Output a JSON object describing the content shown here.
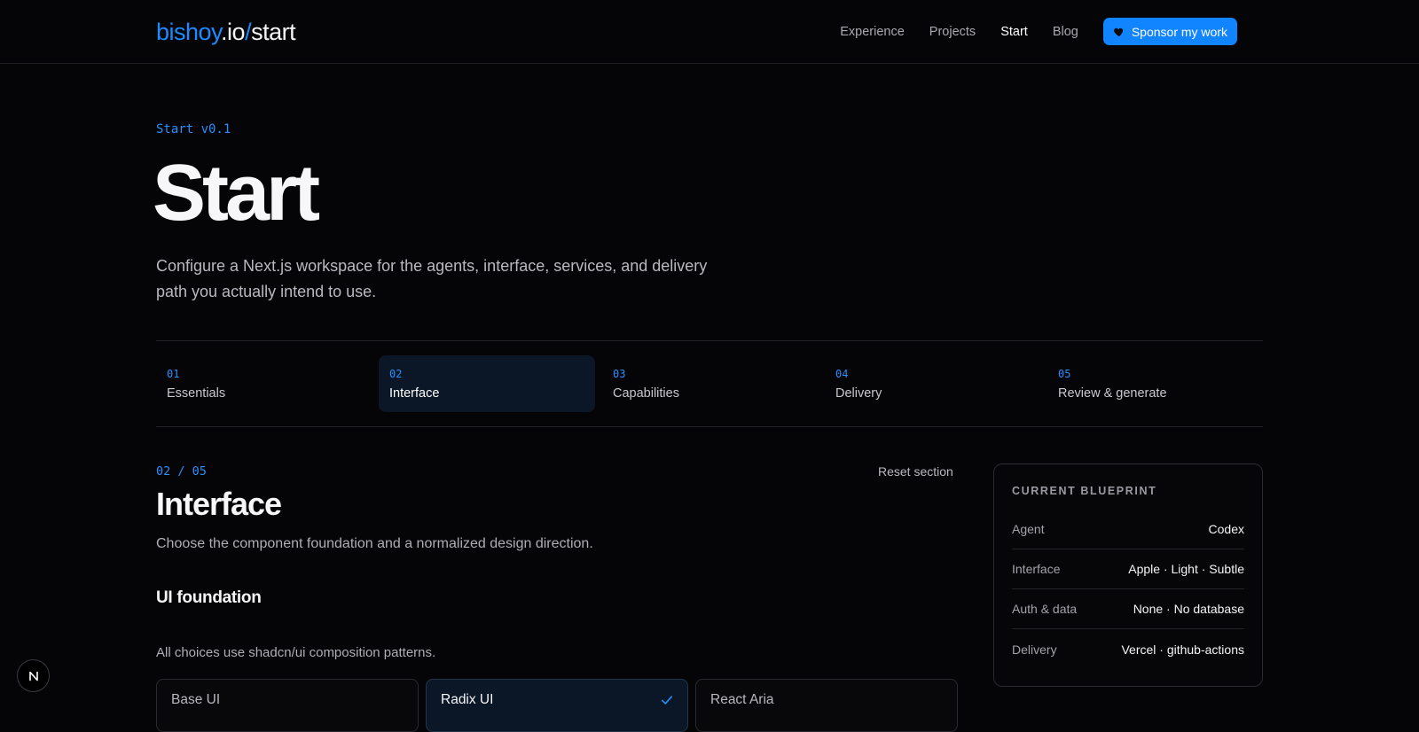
{
  "header": {
    "logo": {
      "brand": "bishoy",
      "tld": ".io",
      "slash": "/",
      "path": "start"
    },
    "nav": [
      "Experience",
      "Projects",
      "Start",
      "Blog"
    ],
    "active_nav": "Start",
    "sponsor_label": "Sponsor my work",
    "sponsor_icon": "heart-icon",
    "accent_color": "#1184ff"
  },
  "hero": {
    "eyebrow": "Start v0.1",
    "title": "Start",
    "description": "Configure a Next.js workspace for the agents, interface, services, and delivery path you actually intend to use."
  },
  "steps": [
    {
      "num": "01",
      "label": "Essentials"
    },
    {
      "num": "02",
      "label": "Interface",
      "active": true
    },
    {
      "num": "03",
      "label": "Capabilities"
    },
    {
      "num": "04",
      "label": "Delivery"
    },
    {
      "num": "05",
      "label": "Review & generate"
    }
  ],
  "section": {
    "counter": "02 / 05",
    "reset_label": "Reset section",
    "title": "Interface",
    "description": "Choose the component foundation and a normalized design direction.",
    "subsection_title": "UI foundation",
    "subsection_desc": "All choices use shadcn/ui composition patterns.",
    "options": [
      {
        "label": "Base UI"
      },
      {
        "label": "Radix UI",
        "selected": true
      },
      {
        "label": "React Aria"
      }
    ]
  },
  "blueprint": {
    "title": "CURRENT BLUEPRINT",
    "rows": [
      {
        "key": "Agent",
        "value": "Codex"
      },
      {
        "key": "Interface",
        "value": "Apple · Light · Subtle"
      },
      {
        "key": "Auth & data",
        "value": "None · No database"
      },
      {
        "key": "Delivery",
        "value": "Vercel · github-actions"
      }
    ]
  },
  "badge": {
    "icon": "nextjs-icon"
  }
}
